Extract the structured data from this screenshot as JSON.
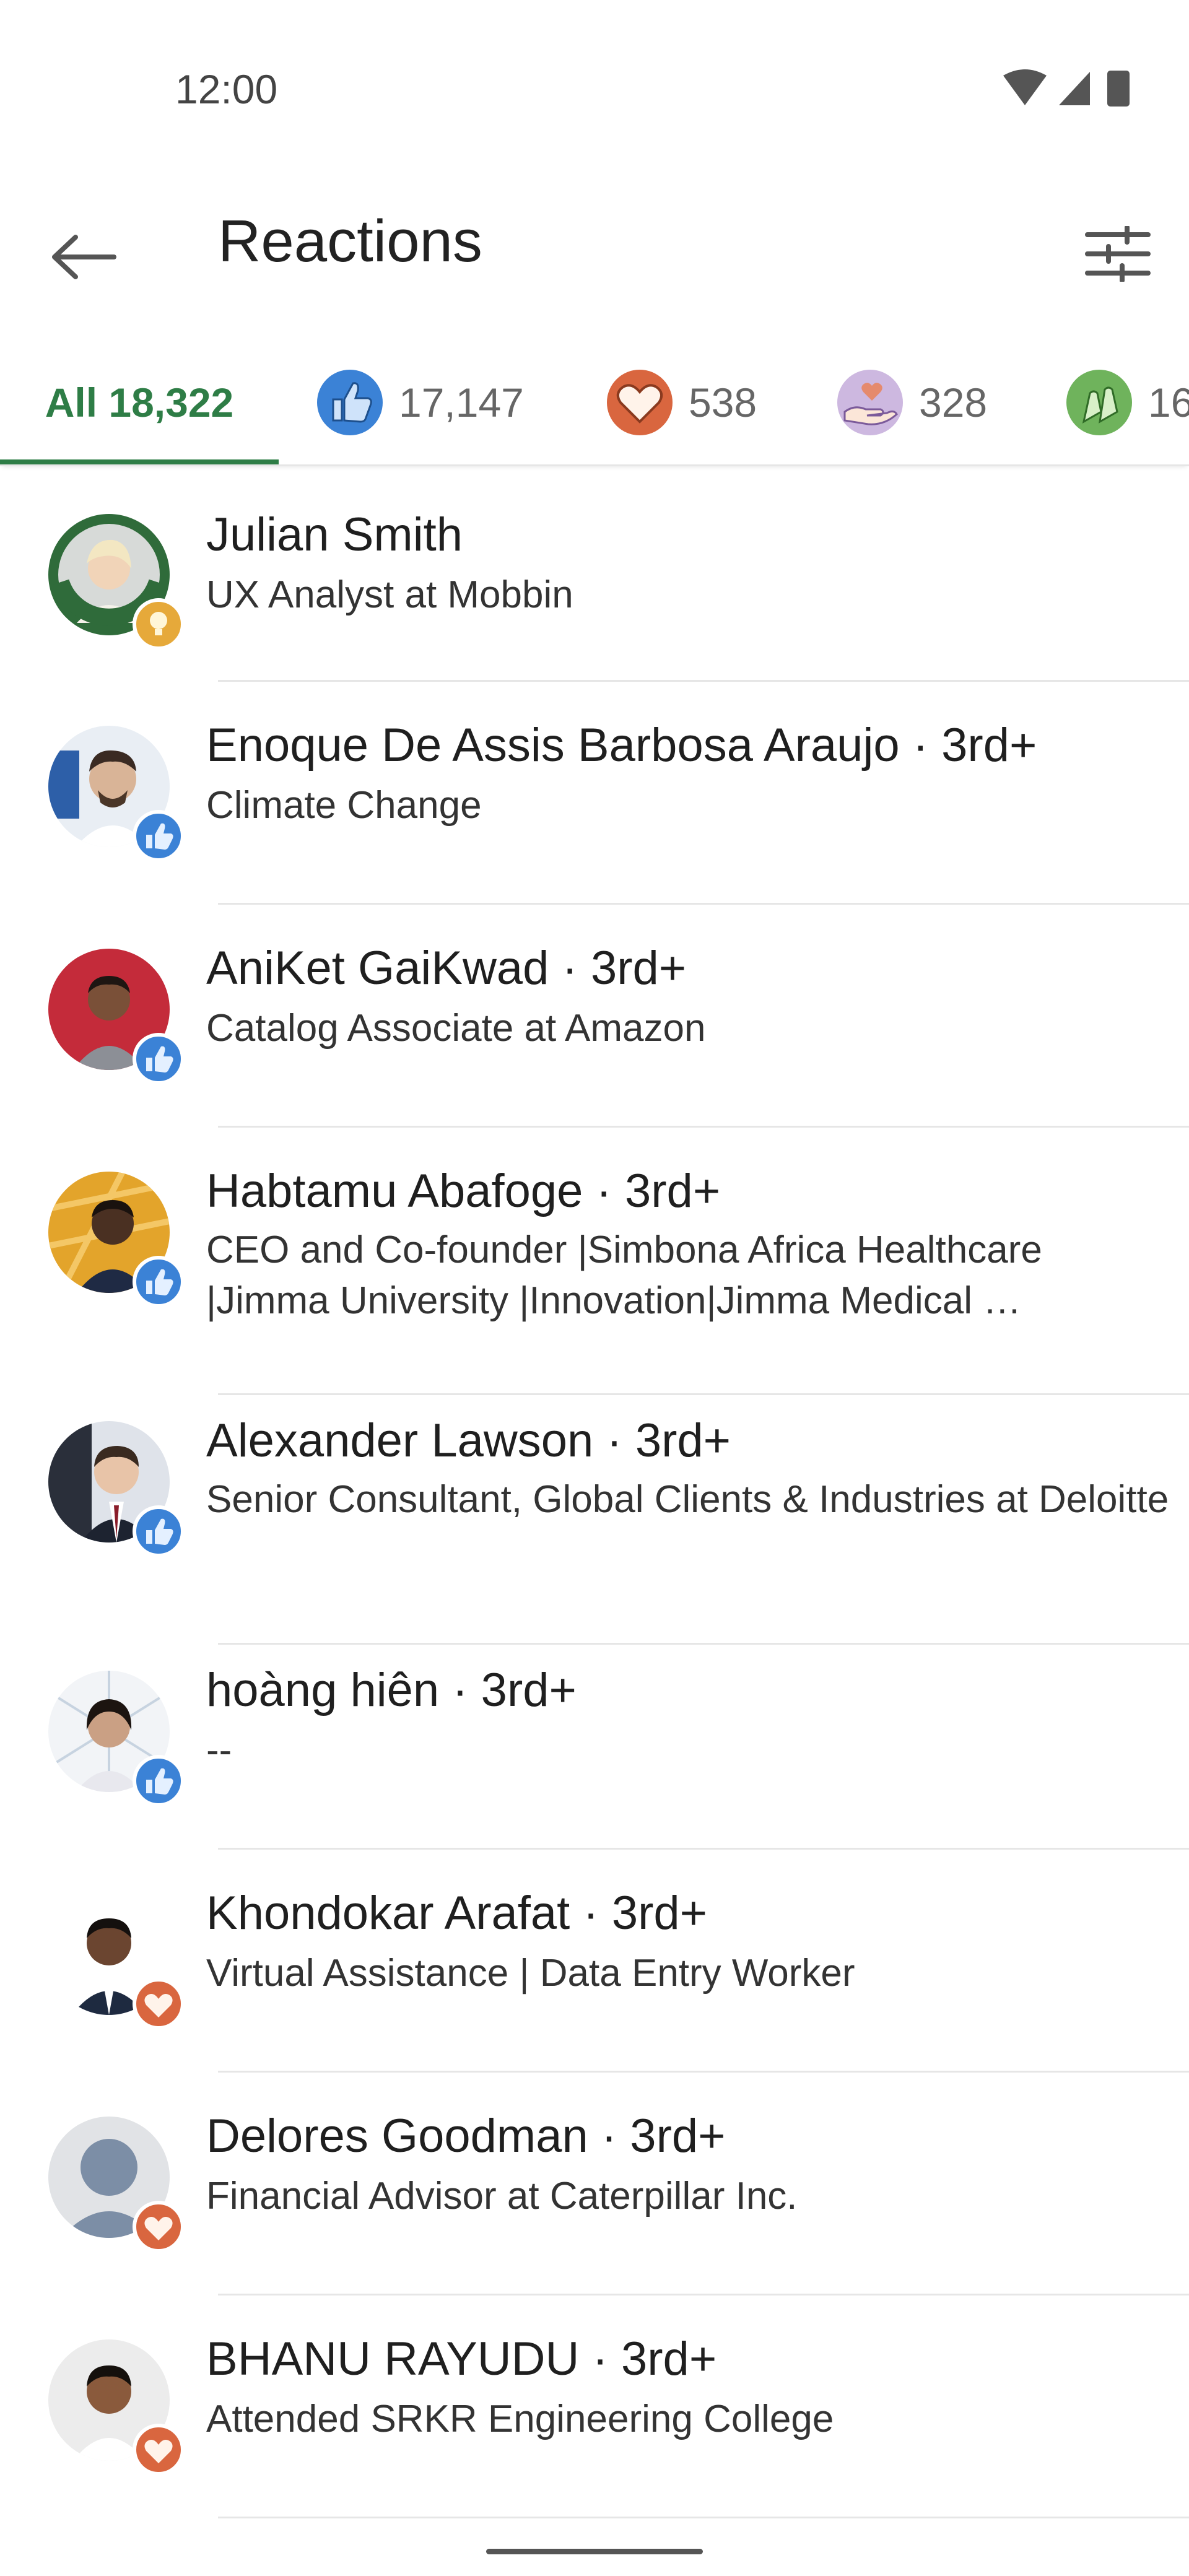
{
  "status_bar": {
    "time": "12:00"
  },
  "app_bar": {
    "title": "Reactions"
  },
  "tabs": [
    {
      "label": "All 18,322",
      "icon": "all"
    },
    {
      "label": "17,147",
      "icon": "like-icon"
    },
    {
      "label": "538",
      "icon": "love-icon"
    },
    {
      "label": "328",
      "icon": "support-icon"
    },
    {
      "label": "16",
      "icon": "celebrate-icon"
    }
  ],
  "reactions": [
    {
      "name": "Julian Smith",
      "subtitle": "UX Analyst at Mobbin",
      "reaction": "insightful-icon"
    },
    {
      "name": "Enoque De Assis Barbosa Araujo · 3rd+",
      "subtitle": "Climate Change",
      "reaction": "like-icon"
    },
    {
      "name": "AniKet GaiKwad · 3rd+",
      "subtitle": "Catalog Associate at Amazon",
      "reaction": "like-icon"
    },
    {
      "name": "Habtamu Abafoge · 3rd+",
      "subtitle": "CEO and Co-founder |Simbona Africa Healthcare |Jimma University |Innovation|Jimma Medical …",
      "reaction": "like-icon"
    },
    {
      "name": "Alexander Lawson · 3rd+",
      "subtitle": "Senior Consultant, Global Clients & Industries at Deloitte",
      "reaction": "like-icon"
    },
    {
      "name": "hoàng hiên · 3rd+",
      "subtitle": "--",
      "reaction": "like-icon"
    },
    {
      "name": "Khondokar Arafat · 3rd+",
      "subtitle": "Virtual Assistance | Data Entry Worker",
      "reaction": "love-icon"
    },
    {
      "name": "Delores Goodman · 3rd+",
      "subtitle": "Financial Advisor at Caterpillar Inc.",
      "reaction": "love-icon"
    },
    {
      "name": "BHANU RAYUDU · 3rd+",
      "subtitle": "Attended SRKR Engineering College",
      "reaction": "love-icon"
    }
  ],
  "colors": {
    "accent": "#2e7d46",
    "like": "#3b82d6",
    "love": "#d9663f",
    "insightful": "#e6a93a"
  }
}
